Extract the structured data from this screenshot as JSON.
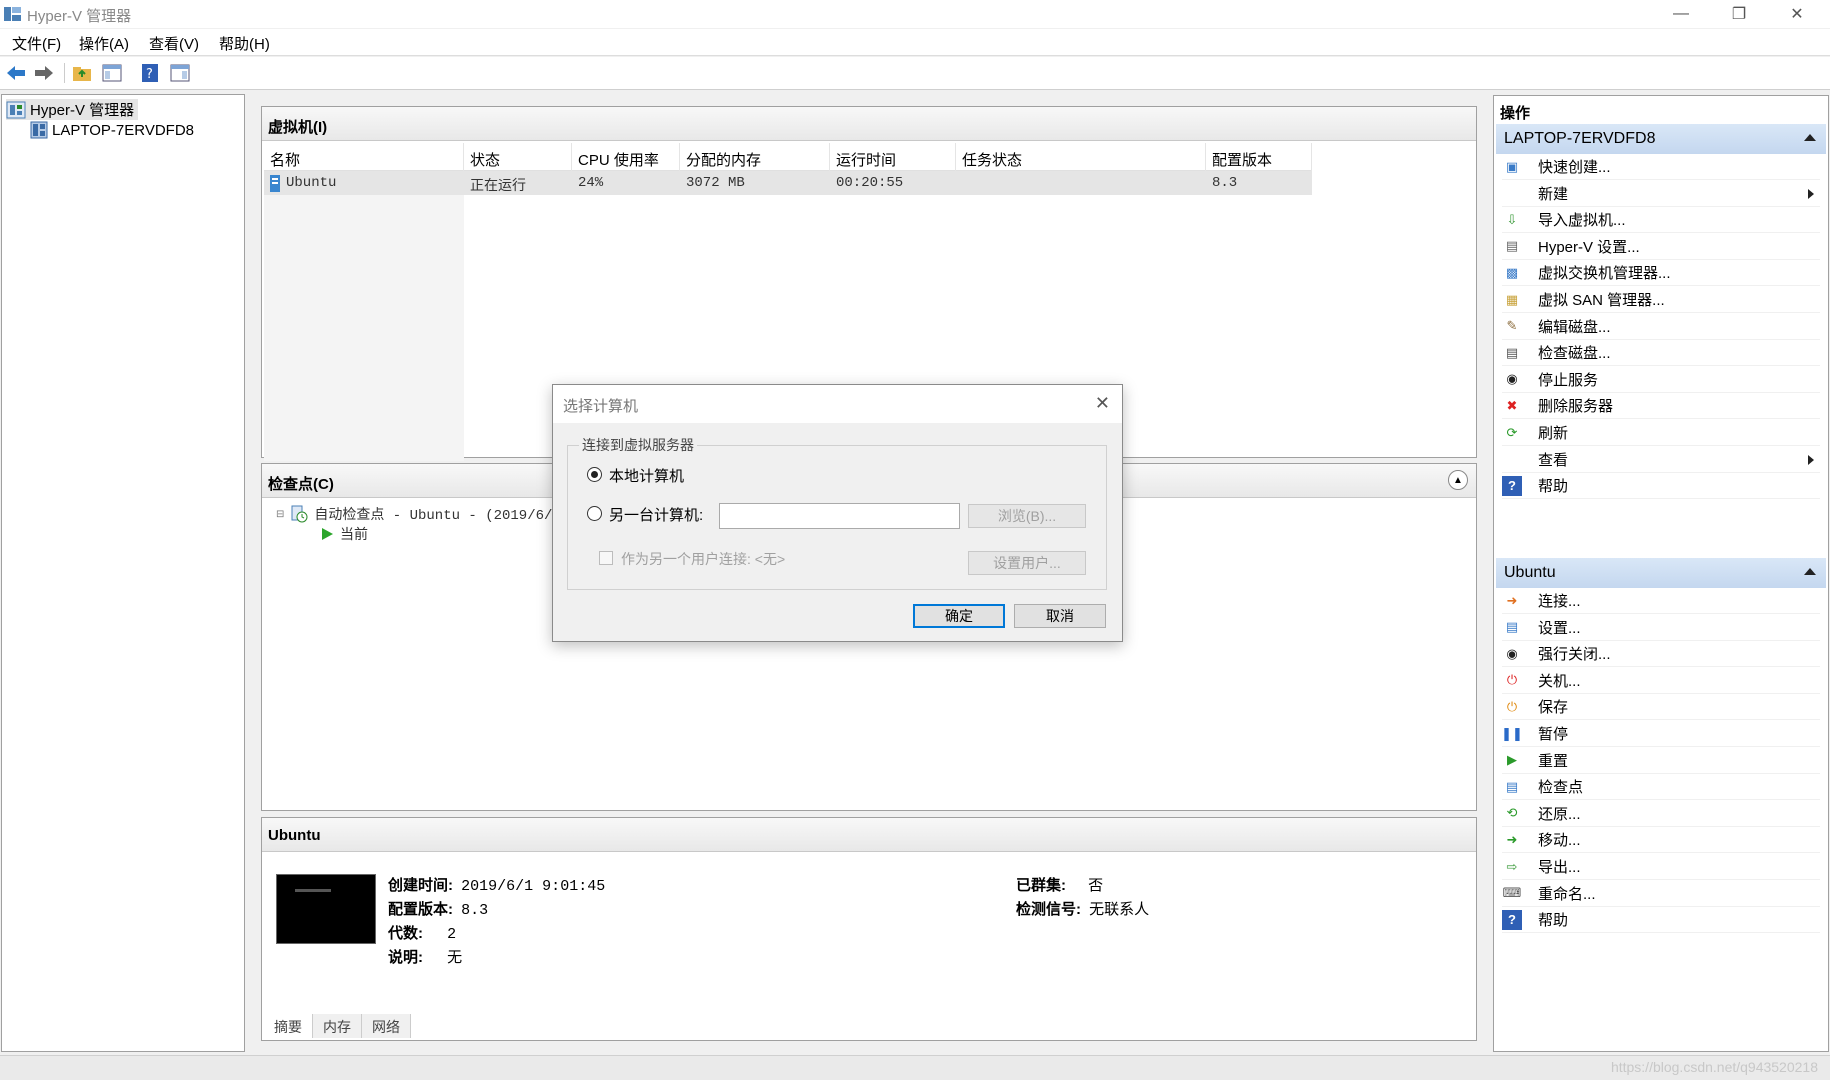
{
  "window": {
    "title": "Hyper-V 管理器",
    "minimize_icon": "minimize-icon",
    "restore_icon": "restore-icon",
    "close_icon": "close-icon"
  },
  "menu": {
    "items": [
      "文件(F)",
      "操作(A)",
      "查看(V)",
      "帮助(H)"
    ]
  },
  "toolbar": {
    "buttons": [
      "back-icon",
      "forward-icon",
      "up-folder-icon",
      "show-hide-tree-icon",
      "help-icon",
      "show-hide-action-pane-icon"
    ]
  },
  "tree": {
    "root": "Hyper-V 管理器",
    "host": "LAPTOP-7ERVDFD8"
  },
  "vms": {
    "title": "虚拟机(I)",
    "columns": [
      "名称",
      "状态",
      "CPU 使用率",
      "分配的内存",
      "运行时间",
      "任务状态",
      "配置版本"
    ],
    "rows": [
      {
        "name": "Ubuntu",
        "state": "正在运行",
        "cpu": "24%",
        "memory": "3072 MB",
        "uptime": "00:20:55",
        "task": "",
        "version": "8.3"
      }
    ]
  },
  "checkpoints": {
    "title": "检查点(C)",
    "auto_checkpoint": "自动检查点 - Ubuntu - (2019/6/1",
    "current": "当前"
  },
  "details": {
    "title": "Ubuntu",
    "created_label": "创建时间:",
    "created_value": "2019/6/1 9:01:45",
    "version_label": "配置版本:",
    "version_value": "8.3",
    "generation_label": "代数:",
    "generation_value": "2",
    "notes_label": "说明:",
    "notes_value": "无",
    "clustered_label": "已群集:",
    "clustered_value": "否",
    "heartbeat_label": "检测信号:",
    "heartbeat_value": "无联系人",
    "tabs": [
      "摘要",
      "内存",
      "网络"
    ]
  },
  "actions": {
    "title": "操作",
    "host_section": "LAPTOP-7ERVDFD8",
    "host_items": [
      {
        "label": "快速创建...",
        "icon": "quick-create-icon"
      },
      {
        "label": "新建",
        "icon": "none",
        "submenu": true
      },
      {
        "label": "导入虚拟机...",
        "icon": "import-vm-icon"
      },
      {
        "label": "Hyper-V 设置...",
        "icon": "hyperv-settings-icon"
      },
      {
        "label": "虚拟交换机管理器...",
        "icon": "virtual-switch-icon"
      },
      {
        "label": "虚拟 SAN 管理器...",
        "icon": "virtual-san-icon"
      },
      {
        "label": "编辑磁盘...",
        "icon": "edit-disk-icon"
      },
      {
        "label": "检查磁盘...",
        "icon": "inspect-disk-icon"
      },
      {
        "label": "停止服务",
        "icon": "stop-service-icon"
      },
      {
        "label": "删除服务器",
        "icon": "remove-server-icon"
      },
      {
        "label": "刷新",
        "icon": "refresh-icon"
      },
      {
        "label": "查看",
        "icon": "none",
        "submenu": true
      },
      {
        "label": "帮助",
        "icon": "help-icon"
      }
    ],
    "vm_section": "Ubuntu",
    "vm_items": [
      {
        "label": "连接...",
        "icon": "connect-icon"
      },
      {
        "label": "设置...",
        "icon": "settings-icon"
      },
      {
        "label": "强行关闭...",
        "icon": "turn-off-icon"
      },
      {
        "label": "关机...",
        "icon": "shutdown-icon"
      },
      {
        "label": "保存",
        "icon": "save-icon"
      },
      {
        "label": "暂停",
        "icon": "pause-icon"
      },
      {
        "label": "重置",
        "icon": "reset-icon"
      },
      {
        "label": "检查点",
        "icon": "checkpoint-icon"
      },
      {
        "label": "还原...",
        "icon": "revert-icon"
      },
      {
        "label": "移动...",
        "icon": "move-icon"
      },
      {
        "label": "导出...",
        "icon": "export-icon"
      },
      {
        "label": "重命名...",
        "icon": "rename-icon"
      },
      {
        "label": "帮助",
        "icon": "help-icon"
      }
    ]
  },
  "dialog": {
    "title": "选择计算机",
    "group_label": "连接到虚拟服务器",
    "local_label": "本地计算机",
    "local_selected": true,
    "other_label": "另一台计算机:",
    "other_value": "",
    "browse_label": "浏览(B)...",
    "as_user_label": "作为另一个用户连接: <无>",
    "set_user_label": "设置用户...",
    "ok_label": "确定",
    "cancel_label": "取消"
  },
  "statusbar": {
    "watermark": "https://blog.csdn.net/q943520218"
  },
  "colors": {
    "section_bg": "#c4d7ef",
    "dialog_default_border": "#0078d7"
  }
}
